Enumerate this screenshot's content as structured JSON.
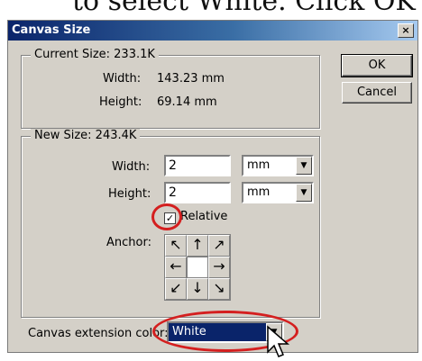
{
  "banner": {
    "text": "to select White. Click OK"
  },
  "dialog": {
    "title": "Canvas Size",
    "close_glyph": "×"
  },
  "current_size": {
    "legend": "Current Size: 233.1K",
    "width_label": "Width:",
    "width_value": "143.23 mm",
    "height_label": "Height:",
    "height_value": "69.14 mm"
  },
  "buttons": {
    "ok": "OK",
    "cancel": "Cancel"
  },
  "new_size": {
    "legend": "New Size: 243.4K",
    "width_label": "Width:",
    "width_value": "2",
    "width_unit": "mm",
    "height_label": "Height:",
    "height_value": "2",
    "height_unit": "mm",
    "relative_label": "Relative",
    "relative_checked": true,
    "anchor_label": "Anchor:",
    "anchor_arrows": [
      "↖",
      "↑",
      "↗",
      "←",
      "",
      "→",
      "↙",
      "↓",
      "↘"
    ]
  },
  "extension": {
    "label": "Canvas extension color:",
    "value": "White"
  },
  "colors": {
    "highlight": "#d41f1f",
    "selection": "#0a246a",
    "dialog": "#d4d0c8"
  }
}
